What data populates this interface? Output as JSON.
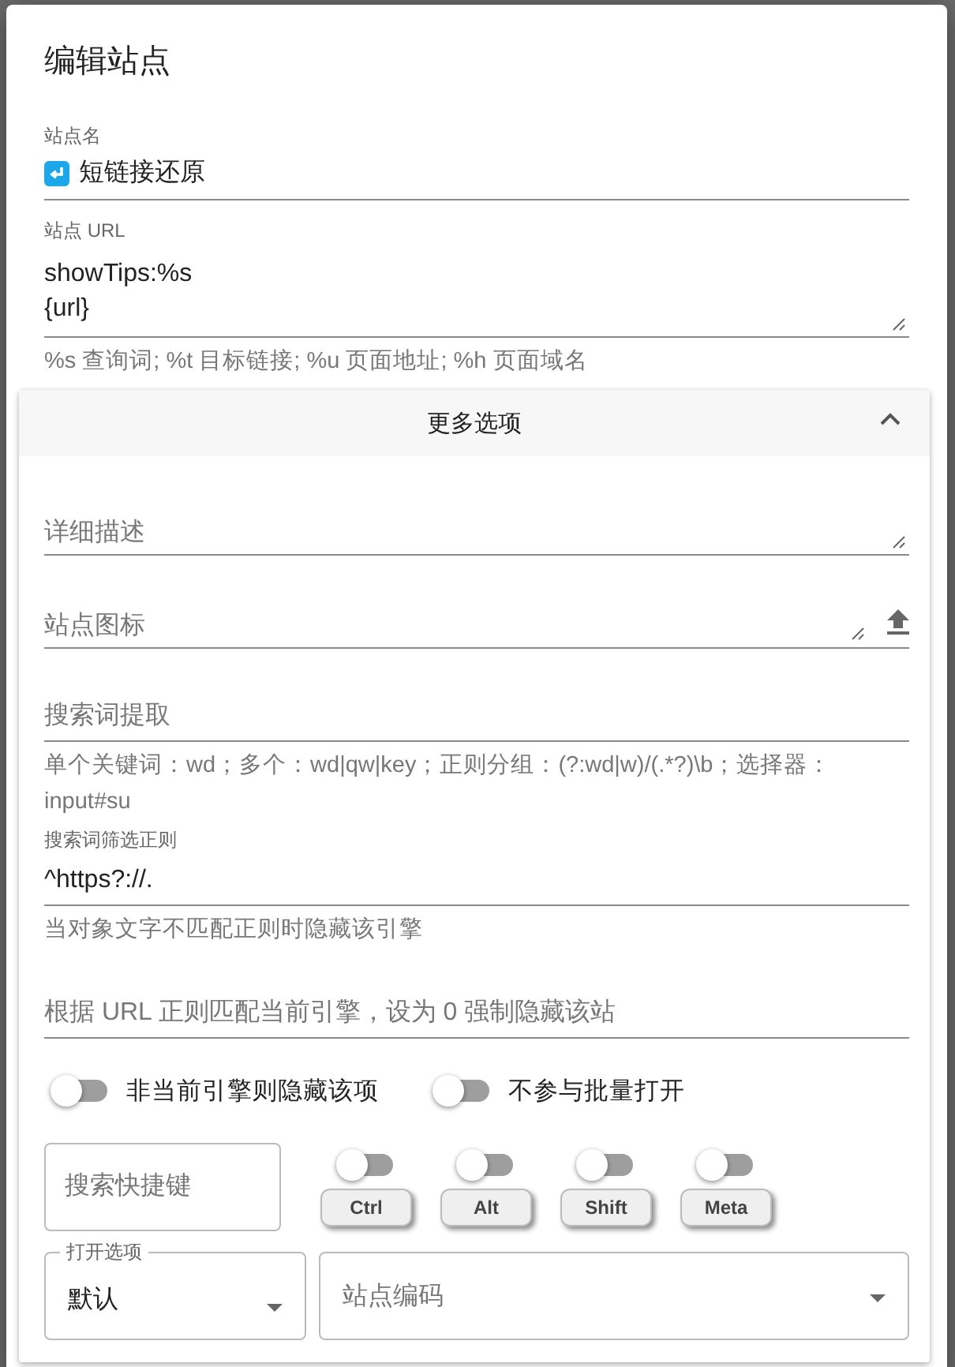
{
  "dialog": {
    "title": "编辑站点"
  },
  "site_name": {
    "label": "站点名",
    "value": "短链接还原"
  },
  "site_url": {
    "label": "站点 URL",
    "value": "showTips:%s\n{url}",
    "hint": "%s 查询词; %t 目标链接; %u 页面地址; %h 页面域名"
  },
  "more_options": {
    "title": "更多选项",
    "expanded": true
  },
  "description": {
    "placeholder": "详细描述"
  },
  "site_icon": {
    "placeholder": "站点图标"
  },
  "keyword_extract": {
    "placeholder": "搜索词提取",
    "hint": "单个关键词：wd；多个：wd|qw|key；正则分组：(?:wd|w)/(.*?)\\b；选择器：input#su"
  },
  "keyword_filter": {
    "label": "搜索词筛选正则",
    "value": "^https?://.",
    "hint": "当对象文字不匹配正则时隐藏该引擎"
  },
  "match_rule": {
    "placeholder": "根据 URL 正则匹配当前引擎，设为 0 强制隐藏该站"
  },
  "switches": [
    {
      "label": "非当前引擎则隐藏该项",
      "on": false
    },
    {
      "label": "不参与批量打开",
      "on": false
    }
  ],
  "shortcut": {
    "placeholder": "搜索快捷键"
  },
  "modifiers": [
    {
      "label": "Ctrl",
      "on": false
    },
    {
      "label": "Alt",
      "on": false
    },
    {
      "label": "Shift",
      "on": false
    },
    {
      "label": "Meta",
      "on": false
    }
  ],
  "open_option": {
    "label": "打开选项",
    "value": "默认"
  },
  "encoding": {
    "placeholder": "站点编码"
  }
}
